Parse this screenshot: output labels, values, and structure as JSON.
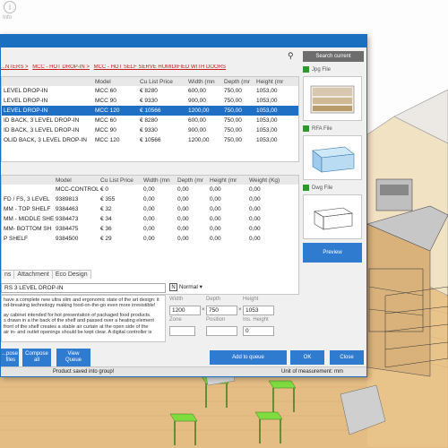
{
  "background": {
    "info_label": "Info"
  },
  "dialog": {
    "search_button": "Search current",
    "breadcrumb": [
      "...NTERS >",
      "MCC - HOT DROP-IN >",
      "MCC - HOT SELF SERVE HUMIDIFIED WITH DOORS"
    ],
    "top_grid": {
      "columns": [
        "",
        "Model",
        "Cu List Price",
        "Width (mn",
        "Depth (mr",
        "Height (mr"
      ],
      "rows": [
        [
          "LEVEL DROP-IN",
          "MCC 60",
          "€   8280",
          "600,00",
          "750,00",
          "1053,00"
        ],
        [
          "LEVEL DROP-IN",
          "MCC 90",
          "€   9330",
          "900,00",
          "750,00",
          "1053,00"
        ],
        [
          "LEVEL DROP-IN",
          "MCC 120",
          "€   10566",
          "1200,00",
          "750,00",
          "1053,00"
        ],
        [
          "ID BACK, 3 LEVEL DROP-IN",
          "MCC 60",
          "€   8280",
          "600,00",
          "750,00",
          "1053,00"
        ],
        [
          "ID BACK, 3 LEVEL DROP-IN",
          "MCC 90",
          "€   9330",
          "900,00",
          "750,00",
          "1053,00"
        ],
        [
          "OLID BACK, 3 LEVEL DROP-IN",
          "MCC 120",
          "€   10566",
          "1200,00",
          "750,00",
          "1053,00"
        ]
      ],
      "selected_row": 2
    },
    "bottom_grid": {
      "columns": [
        "",
        "Model",
        "Cu List Price",
        "Width (mn",
        "Depth (mr",
        "Height (mr",
        "Weight (Kg)"
      ],
      "rows": [
        [
          "",
          "MCC-CONTROL-",
          "€   0",
          "0,00",
          "0,00",
          "0,00",
          "0,00"
        ],
        [
          "FD / FS, 3 LEVEL",
          "9389813",
          "€   355",
          "0,00",
          "0,00",
          "0,00",
          "0,00"
        ],
        [
          "MM - TOP SHELF",
          "9384463",
          "€   32",
          "0,00",
          "0,00",
          "0,00",
          "0,00"
        ],
        [
          "MM - MIDDLE SHE",
          "9384473",
          "€   34",
          "0,00",
          "0,00",
          "0,00",
          "0,00"
        ],
        [
          "MM- BOTTOM SH",
          "9384475",
          "€   36",
          "0,00",
          "0,00",
          "0,00",
          "0,00"
        ],
        [
          "P SHELF",
          "9384500",
          "€   29",
          "0,00",
          "0,00",
          "0,00",
          "0,00"
        ]
      ]
    },
    "files": [
      {
        "label": "Jpg File"
      },
      {
        "label": "RFA File"
      },
      {
        "label": "Dwg File"
      }
    ],
    "preview_button": "Preview",
    "tabs": [
      "ns",
      "Attachment",
      "Eco Design"
    ],
    "description_title": "RS 3 LEVEL DROP-IN",
    "description_body": [
      "have a complete new ultra slim and ergonomic state of the art design: it",
      "nd-breaking technology making food-on-the-go even more irresistible!",
      "",
      "ay cabinet intended for hot presentation of packaged food products.",
      "s drawn in a the back of the shelf and passed over a heating element",
      "front of the shelf creates a stable air curtain at the open side of the",
      "air in- and outlet openings should be kept clear. A digital controller is"
    ],
    "normal": {
      "key": "N",
      "value": "Normal"
    },
    "dimensions": {
      "width_label": "Width",
      "depth_label": "Depth",
      "height_label": "Height",
      "width": "1200",
      "depth": "750",
      "height": "1053",
      "zone_label": "Zone",
      "position_label": "Position",
      "ins_height_label": "Ins. Height",
      "zone": "",
      "position": "",
      "ins_height": "0"
    },
    "buttons": {
      "compose_files": "...pose\n files",
      "compose_all": "Compose\nall",
      "view_queue": "View\nQueue",
      "add_to_queue": "Add to queue",
      "ok": "OK",
      "close": "Close"
    },
    "status": {
      "message": "Product saved into group!",
      "unit": "Unit of measurement: mm"
    },
    "colors": {
      "accent": "#1f6fc5",
      "link": "#c02020",
      "file_badge": "#2a9a2a"
    }
  }
}
